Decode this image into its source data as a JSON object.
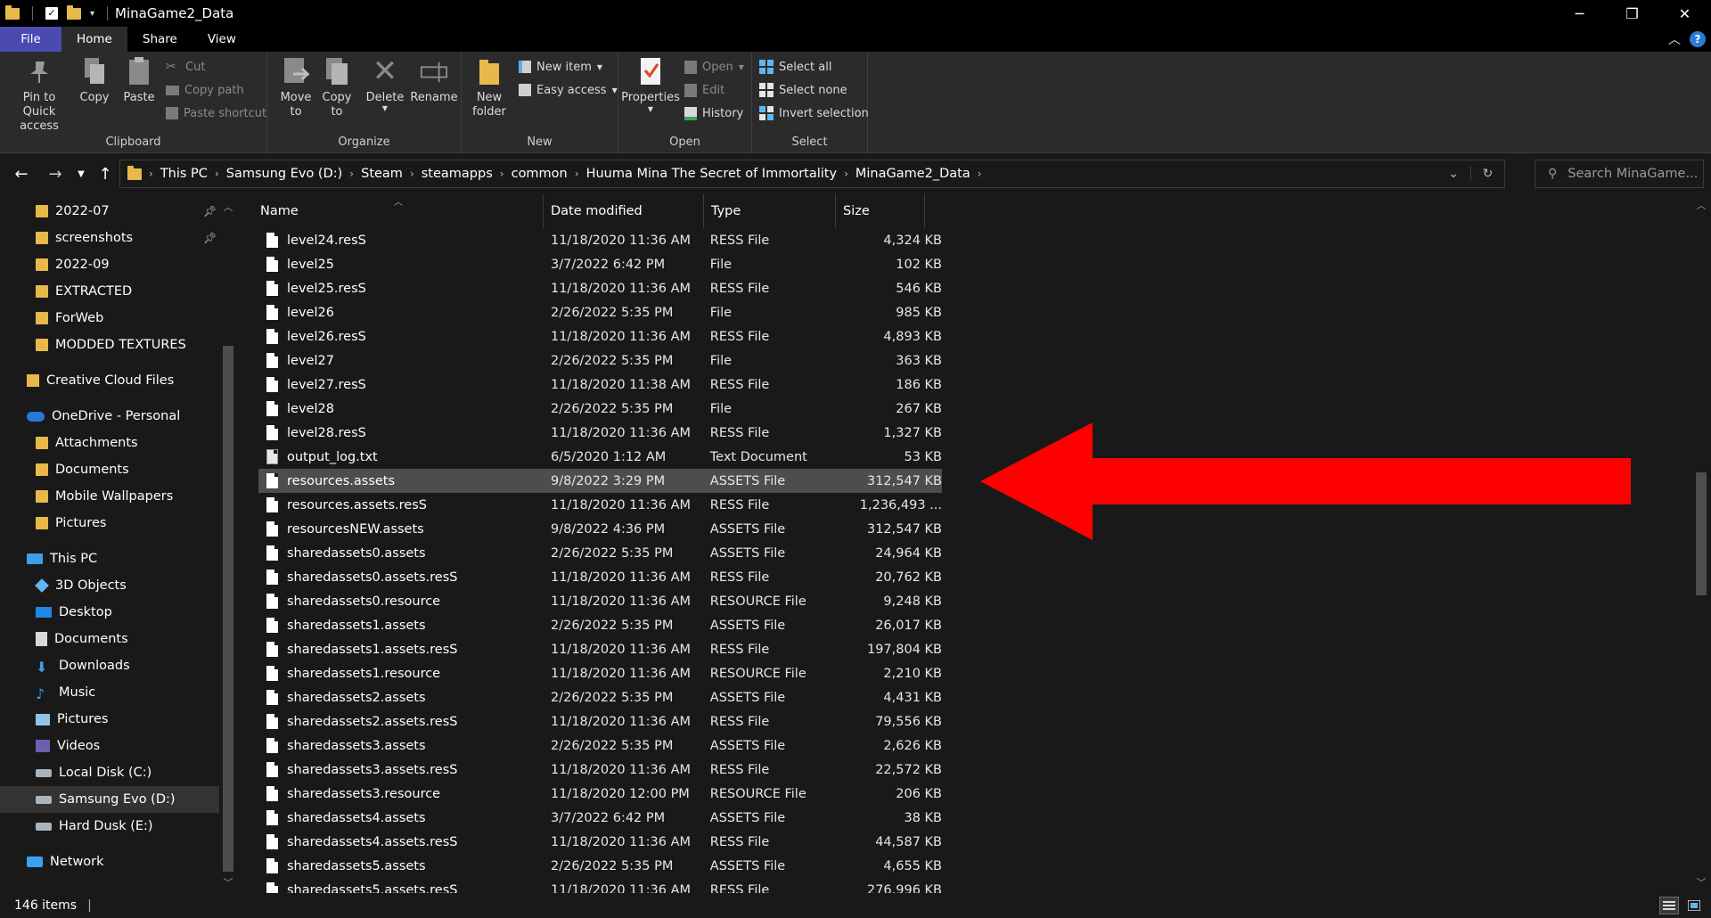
{
  "window": {
    "title": "MinaGame2_Data",
    "controls": {
      "minimize": "─",
      "maximize": "❐",
      "close": "✕"
    }
  },
  "ribbon_tabs": [
    "File",
    "Home",
    "Share",
    "View"
  ],
  "ribbon": {
    "clipboard": {
      "label": "Clipboard",
      "pin": "Pin to Quick\naccess",
      "copy": "Copy",
      "paste": "Paste",
      "cut": "Cut",
      "copy_path": "Copy path",
      "paste_shortcut": "Paste shortcut"
    },
    "organize": {
      "label": "Organize",
      "move_to": "Move\nto",
      "copy_to": "Copy\nto",
      "delete": "Delete",
      "rename": "Rename"
    },
    "new": {
      "label": "New",
      "new_folder": "New\nfolder",
      "new_item": "New item",
      "easy_access": "Easy access"
    },
    "open": {
      "label": "Open",
      "properties": "Properties",
      "open": "Open",
      "edit": "Edit",
      "history": "History"
    },
    "select": {
      "label": "Select",
      "select_all": "Select all",
      "select_none": "Select none",
      "invert_selection": "Invert selection"
    }
  },
  "address": {
    "breadcrumbs": [
      "This PC",
      "Samsung Evo (D:)",
      "Steam",
      "steamapps",
      "common",
      "Huuma Mina The Secret of Immortality",
      "MinaGame2_Data"
    ],
    "search_placeholder": "Search MinaGame..."
  },
  "nav": {
    "quick_access": [
      {
        "label": "2022-07",
        "pinned": true
      },
      {
        "label": "screenshots",
        "pinned": true
      },
      {
        "label": "2022-09",
        "pinned": false
      },
      {
        "label": "EXTRACTED",
        "pinned": false
      },
      {
        "label": "ForWeb",
        "pinned": false
      },
      {
        "label": "MODDED TEXTURES",
        "pinned": false
      }
    ],
    "creative_cloud": "Creative Cloud Files",
    "onedrive": "OneDrive - Personal",
    "onedrive_items": [
      "Attachments",
      "Documents",
      "Mobile Wallpapers",
      "Pictures"
    ],
    "this_pc": "This PC",
    "this_pc_items": [
      "3D Objects",
      "Desktop",
      "Documents",
      "Downloads",
      "Music",
      "Pictures",
      "Videos"
    ],
    "drives": [
      "Local Disk (C:)",
      "Samsung Evo (D:)",
      "Hard Dusk (E:)"
    ],
    "selected_drive": "Samsung Evo (D:)",
    "network": "Network"
  },
  "columns": {
    "name": "Name",
    "date": "Date modified",
    "type": "Type",
    "size": "Size"
  },
  "files": [
    {
      "name": "level24.resS",
      "date": "11/18/2020 11:36 AM",
      "type": "RESS File",
      "size": "4,324 KB"
    },
    {
      "name": "level25",
      "date": "3/7/2022 6:42 PM",
      "type": "File",
      "size": "102 KB"
    },
    {
      "name": "level25.resS",
      "date": "11/18/2020 11:36 AM",
      "type": "RESS File",
      "size": "546 KB"
    },
    {
      "name": "level26",
      "date": "2/26/2022 5:35 PM",
      "type": "File",
      "size": "985 KB"
    },
    {
      "name": "level26.resS",
      "date": "11/18/2020 11:36 AM",
      "type": "RESS File",
      "size": "4,893 KB"
    },
    {
      "name": "level27",
      "date": "2/26/2022 5:35 PM",
      "type": "File",
      "size": "363 KB"
    },
    {
      "name": "level27.resS",
      "date": "11/18/2020 11:38 AM",
      "type": "RESS File",
      "size": "186 KB"
    },
    {
      "name": "level28",
      "date": "2/26/2022 5:35 PM",
      "type": "File",
      "size": "267 KB"
    },
    {
      "name": "level28.resS",
      "date": "11/18/2020 11:36 AM",
      "type": "RESS File",
      "size": "1,327 KB"
    },
    {
      "name": "output_log.txt",
      "date": "6/5/2020 1:12 AM",
      "type": "Text Document",
      "size": "53 KB"
    },
    {
      "name": "resources.assets",
      "date": "9/8/2022 3:29 PM",
      "type": "ASSETS File",
      "size": "312,547 KB",
      "selected": true
    },
    {
      "name": "resources.assets.resS",
      "date": "11/18/2020 11:36 AM",
      "type": "RESS File",
      "size": "1,236,493 ..."
    },
    {
      "name": "resourcesNEW.assets",
      "date": "9/8/2022 4:36 PM",
      "type": "ASSETS File",
      "size": "312,547 KB"
    },
    {
      "name": "sharedassets0.assets",
      "date": "2/26/2022 5:35 PM",
      "type": "ASSETS File",
      "size": "24,964 KB"
    },
    {
      "name": "sharedassets0.assets.resS",
      "date": "11/18/2020 11:36 AM",
      "type": "RESS File",
      "size": "20,762 KB"
    },
    {
      "name": "sharedassets0.resource",
      "date": "11/18/2020 11:36 AM",
      "type": "RESOURCE File",
      "size": "9,248 KB"
    },
    {
      "name": "sharedassets1.assets",
      "date": "2/26/2022 5:35 PM",
      "type": "ASSETS File",
      "size": "26,017 KB"
    },
    {
      "name": "sharedassets1.assets.resS",
      "date": "11/18/2020 11:36 AM",
      "type": "RESS File",
      "size": "197,804 KB"
    },
    {
      "name": "sharedassets1.resource",
      "date": "11/18/2020 11:36 AM",
      "type": "RESOURCE File",
      "size": "2,210 KB"
    },
    {
      "name": "sharedassets2.assets",
      "date": "2/26/2022 5:35 PM",
      "type": "ASSETS File",
      "size": "4,431 KB"
    },
    {
      "name": "sharedassets2.assets.resS",
      "date": "11/18/2020 11:36 AM",
      "type": "RESS File",
      "size": "79,556 KB"
    },
    {
      "name": "sharedassets3.assets",
      "date": "2/26/2022 5:35 PM",
      "type": "ASSETS File",
      "size": "2,626 KB"
    },
    {
      "name": "sharedassets3.assets.resS",
      "date": "11/18/2020 11:36 AM",
      "type": "RESS File",
      "size": "22,572 KB"
    },
    {
      "name": "sharedassets3.resource",
      "date": "11/18/2020 12:00 PM",
      "type": "RESOURCE File",
      "size": "206 KB"
    },
    {
      "name": "sharedassets4.assets",
      "date": "3/7/2022 6:42 PM",
      "type": "ASSETS File",
      "size": "38 KB"
    },
    {
      "name": "sharedassets4.assets.resS",
      "date": "11/18/2020 11:36 AM",
      "type": "RESS File",
      "size": "44,587 KB"
    },
    {
      "name": "sharedassets5.assets",
      "date": "2/26/2022 5:35 PM",
      "type": "ASSETS File",
      "size": "4,655 KB"
    },
    {
      "name": "sharedassets5.assets.resS",
      "date": "11/18/2020 11:36 AM",
      "type": "RESS File",
      "size": "276,996 KB"
    }
  ],
  "status": {
    "item_count": "146 items"
  },
  "colors": {
    "accent_file_tab": "#4a4ab0",
    "annotation_arrow": "#ff0000",
    "folder": "#e8b94a"
  }
}
